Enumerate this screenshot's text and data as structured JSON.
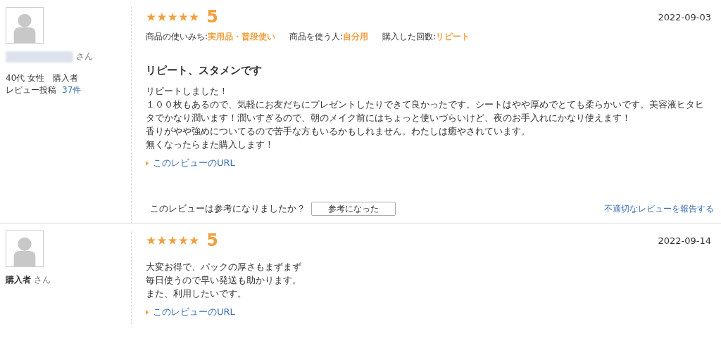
{
  "reviews": [
    {
      "reviewer": {
        "name_blurred": true,
        "suffix": "さん",
        "profile": "40代 女性　購入者",
        "post_label": "レビュー投稿",
        "post_count": "37件"
      },
      "stars": 5,
      "rating": "5",
      "date": "2022-09-03",
      "attributes": [
        {
          "label": "商品の使いみち:",
          "value": "実用品・普段使い"
        },
        {
          "label": "商品を使う人:",
          "value": "自分用"
        },
        {
          "label": "購入した回数:",
          "value": "リピート"
        }
      ],
      "title": "リピート、スタメンです",
      "body": [
        "リピートしました！",
        "１００枚もあるので、気軽にお友だちにプレゼントしたりできて良かったです。シートはやや厚めでとても柔らかいです。美容液ヒタヒタでかなり潤います！潤いすぎるので、朝のメイク前にはちょっと使いづらいけど、夜のお手入れにかなり使えます！",
        "香りがやや強めについてるので苦手な方もいるかもしれません。わたしは癒やされています。",
        "無くなったらまた購入します！"
      ],
      "url_link": "このレビューのURL",
      "helpful_question": "このレビューは参考になりましたか？",
      "helpful_button": "参考になった",
      "report_link": "不適切なレビューを報告する"
    },
    {
      "reviewer": {
        "name_blurred": false,
        "name": "購入者",
        "suffix": "さん"
      },
      "stars": 5,
      "rating": "5",
      "date": "2022-09-14",
      "body": [
        "大変お得で、パックの厚さもまずまず",
        "毎日使うので早い発送も助かります。",
        "また、利用したいです。"
      ],
      "url_link": "このレビューのURL"
    }
  ]
}
